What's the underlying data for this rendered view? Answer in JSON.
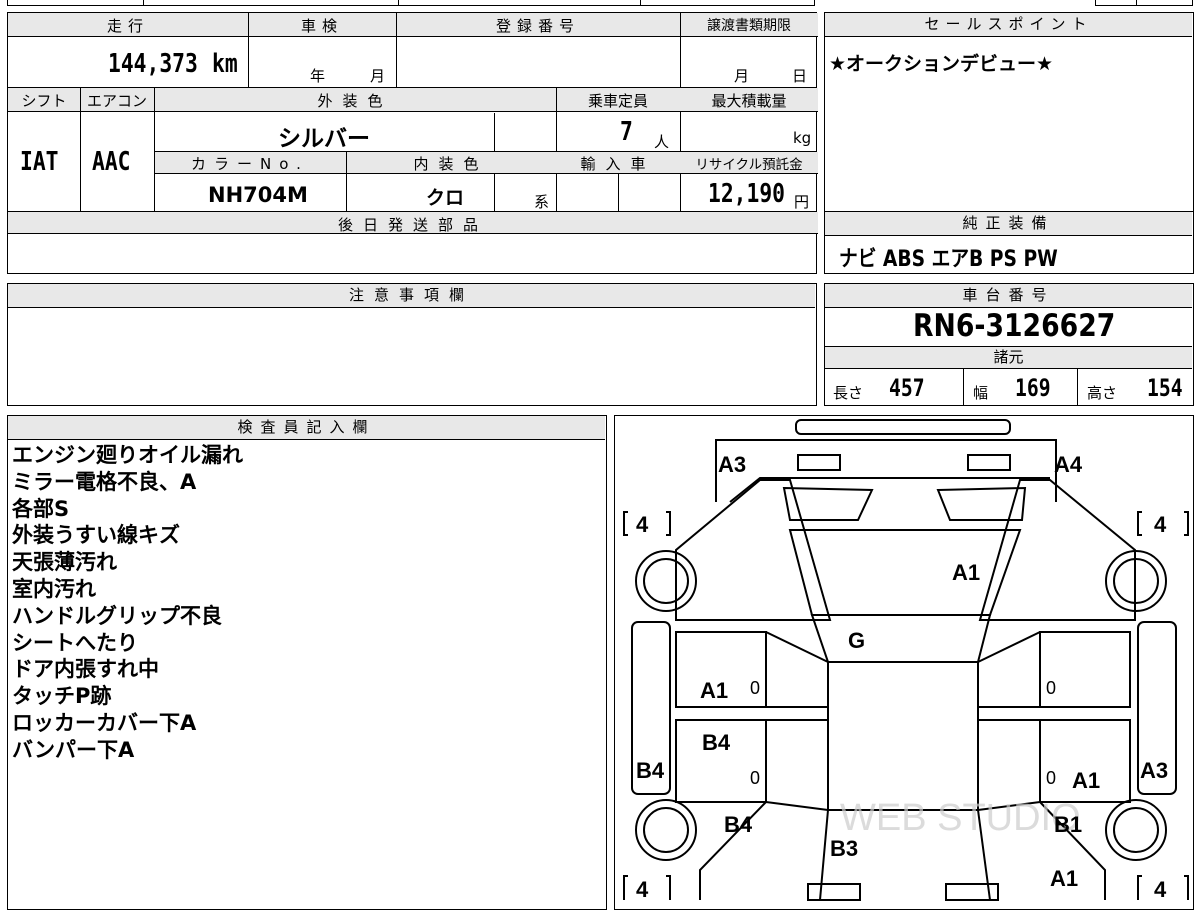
{
  "top_strip": {
    "partial_text": ""
  },
  "spec_table": {
    "mileage_label": "走行",
    "mileage_value": "144,373",
    "mileage_unit": "km",
    "inspection_label": "車検",
    "inspection_year": "年",
    "inspection_month": "月",
    "reg_number_label": "登録番号",
    "transfer_label": "譲渡書類期限",
    "transfer_month": "月",
    "transfer_day": "日",
    "shift_label": "シフト",
    "shift_value": "IAT",
    "ac_label": "エアコン",
    "ac_value": "AAC",
    "exterior_label": "外装色",
    "exterior_value": "シルバー",
    "capacity_label": "乗車定員",
    "capacity_value": "7",
    "capacity_unit": "人",
    "load_label": "最大積載量",
    "load_unit": "kg",
    "color_no_label": "カラーNo.",
    "color_no_value": "NH704M",
    "interior_label": "内装色",
    "interior_value": "クロ",
    "interior_suffix": "系",
    "import_label": "輸入車",
    "recycle_label": "リサイクル預託金",
    "recycle_value": "12,190",
    "recycle_unit": "円",
    "later_parts_label": "後日発送部品"
  },
  "sales_point": {
    "label": "セールスポイント",
    "text": "★オークションデビュー★"
  },
  "equipment": {
    "label": "純正装備",
    "value": "ナビ ABS エアB PS PW"
  },
  "notes_section": {
    "label": "注意事項欄"
  },
  "chassis": {
    "label": "車台番号",
    "value": "RN6-3126627",
    "spec_label": "諸元",
    "length_label": "長さ",
    "length_value": "457",
    "width_label": "幅",
    "width_value": "169",
    "height_label": "高さ",
    "height_value": "154"
  },
  "inspector": {
    "label": "検査員記入欄",
    "notes": [
      "エンジン廻りオイル漏れ",
      "ミラー電格不良、A",
      "各部S",
      "外装うすい線キズ",
      "天張薄汚れ",
      "室内汚れ",
      "ハンドルグリップ不良",
      "シートへたり",
      "ドア内張すれ中",
      "タッチP跡",
      "ロッカーカバー下A",
      "バンパー下A"
    ]
  },
  "diagram": {
    "marks": {
      "front_left": "A3",
      "front_right": "A4",
      "hood": "A1",
      "windshield": "G",
      "front_left_door": "A1",
      "rear_left_door": "B4",
      "left_quarter": "B4",
      "left_rear_side": "B4",
      "right_rear_side": "A3",
      "rear_right_door": "A1",
      "right_quarter": "B1",
      "rear_right_corner": "A1",
      "rear_center": "B3"
    },
    "tires": {
      "tl": "4",
      "tr": "4",
      "bl": "4",
      "br": "4"
    },
    "door_zeros": [
      "0",
      "0",
      "0",
      "0"
    ],
    "watermark": "WEB STUDIO"
  }
}
